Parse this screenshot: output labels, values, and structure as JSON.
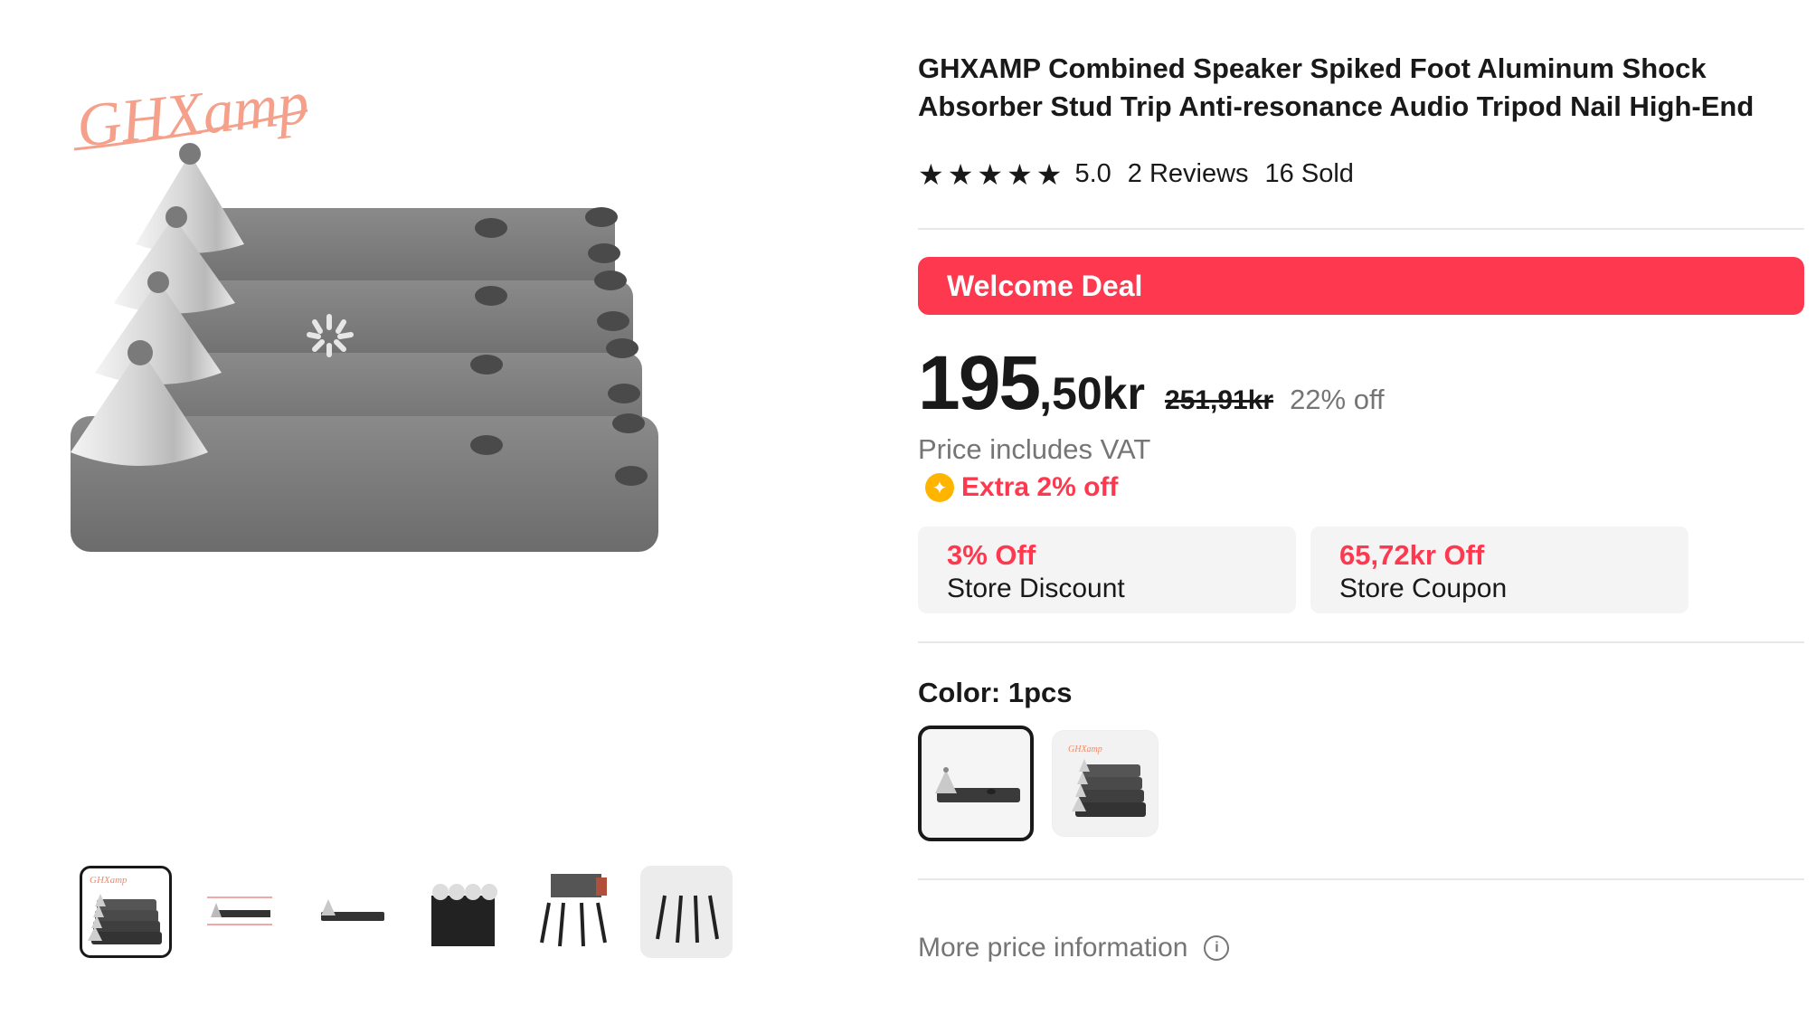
{
  "product": {
    "title": "GHXAMP Combined Speaker Spiked Foot Aluminum Shock Absorber Stud Trip Anti-resonance Audio Tripod Nail High-End",
    "rating": "5.0",
    "stars": 5,
    "reviews": "2 Reviews",
    "sold": "16 Sold"
  },
  "gallery": {
    "brand_logo": "GHXamp",
    "thumbnail_count": 6,
    "active_thumbnail": 0
  },
  "deal": {
    "banner": "Welcome Deal"
  },
  "price": {
    "integer": "195",
    "decimal": ",50kr",
    "original": "251,91kr",
    "discount": "22% off",
    "vat_note": "Price includes VAT",
    "extra_off": "Extra 2% off"
  },
  "coupons": [
    {
      "value": "3% Off",
      "label": "Store Discount"
    },
    {
      "value": "65,72kr Off",
      "label": "Store Coupon"
    }
  ],
  "color": {
    "label": "Color: 1pcs"
  },
  "more_price_info": "More price information",
  "colors": {
    "accent": "#fd384f",
    "coin": "#ffb400",
    "text": "#191919",
    "muted": "#757575"
  },
  "icons": {
    "star": "star-icon",
    "coin": "coin-icon",
    "info": "info-icon"
  }
}
